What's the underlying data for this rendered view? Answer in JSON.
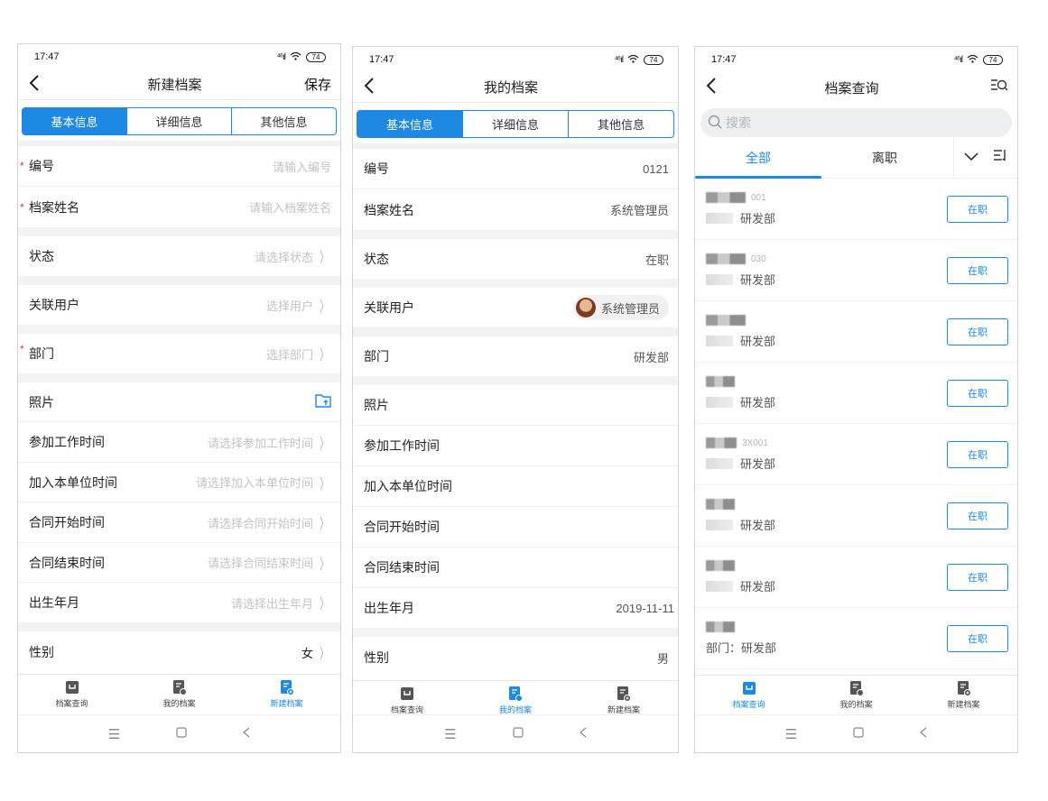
{
  "status_bar": {
    "time": "17:47",
    "signal": "⁴⁶ıl",
    "battery": "74"
  },
  "screen1": {
    "title": "新建档案",
    "save_label": "保存",
    "tabs": [
      "基本信息",
      "详细信息",
      "其他信息"
    ],
    "fields": [
      {
        "label": "编号",
        "value": "请输入编号",
        "required": "*"
      },
      {
        "label": "档案姓名",
        "value": "请输入档案姓名",
        "required": "*"
      },
      {
        "label": "状态",
        "value": "请选择状态"
      },
      {
        "label": "关联用户",
        "value": "选择用户"
      },
      {
        "label": "部门",
        "value": "选择部门",
        "required": "*"
      },
      {
        "label": "照片",
        "value": ""
      },
      {
        "label": "参加工作时间",
        "value": "请选择参加工作时间"
      },
      {
        "label": "加入本单位时间",
        "value": "请选择加入本单位时间"
      },
      {
        "label": "合同开始时间",
        "value": "请选择合同开始时间"
      },
      {
        "label": "合同结束时间",
        "value": "请选择合同结束时间"
      },
      {
        "label": "出生年月",
        "value": "请选择出生年月"
      },
      {
        "label": "性别",
        "value": "女"
      }
    ]
  },
  "screen2": {
    "title": "我的档案",
    "tabs": [
      "基本信息",
      "详细信息",
      "其他信息"
    ],
    "fields": [
      {
        "label": "编号",
        "value": "0121"
      },
      {
        "label": "档案姓名",
        "value": "系统管理员"
      },
      {
        "label": "状态",
        "value": "在职"
      },
      {
        "label": "关联用户",
        "value": "系统管理员"
      },
      {
        "label": "部门",
        "value": "研发部"
      },
      {
        "label": "照片",
        "value": ""
      },
      {
        "label": "参加工作时间",
        "value": ""
      },
      {
        "label": "加入本单位时间",
        "value": ""
      },
      {
        "label": "合同开始时间",
        "value": ""
      },
      {
        "label": "合同结束时间",
        "value": ""
      },
      {
        "label": "出生年月",
        "value": "2019-11-11"
      },
      {
        "label": "性别",
        "value": "男"
      }
    ]
  },
  "screen3": {
    "title": "档案查询",
    "search_placeholder": "搜索",
    "filter_tabs": [
      "全部",
      "离职"
    ],
    "items": [
      {
        "code": "001",
        "dept": "研发部",
        "status": "在职"
      },
      {
        "code": "030",
        "dept": "研发部",
        "status": "在职"
      },
      {
        "code": "",
        "dept": "研发部",
        "status": "在职"
      },
      {
        "code": "",
        "dept": "研发部",
        "status": "在职"
      },
      {
        "code": "3X001",
        "dept": "研发部",
        "status": "在职"
      },
      {
        "code": "",
        "dept": "研发部",
        "status": "在职"
      },
      {
        "code": "",
        "dept": "研发部",
        "status": "在职"
      },
      {
        "code": "",
        "dept": "部门：研发部",
        "status": "在职"
      }
    ]
  },
  "bottom_tabs": [
    "档案查询",
    "我的档案",
    "新建档案"
  ],
  "colors": {
    "accent": "#1e88e5",
    "required": "#e53935"
  }
}
